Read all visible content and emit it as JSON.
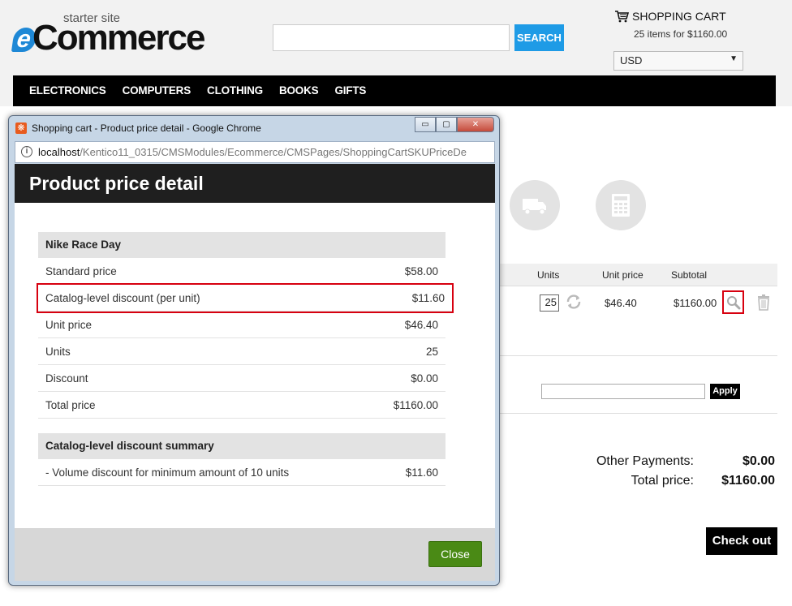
{
  "site": {
    "logo_tagline": "starter site",
    "logo_letter": "e",
    "logo_word": "Commerce",
    "search_placeholder": "",
    "search_button": "SEARCH",
    "cart_label": "SHOPPING CART",
    "cart_summary": "25 items for $1160.00",
    "currency": "USD",
    "nav": [
      "ELECTRONICS",
      "COMPUTERS",
      "CLOTHING",
      "BOOKS",
      "GIFTS"
    ]
  },
  "cart": {
    "columns": {
      "units": "Units",
      "unit_price": "Unit price",
      "subtotal": "Subtotal"
    },
    "row": {
      "units": "25",
      "unit_price": "$46.40",
      "subtotal": "$1160.00"
    },
    "coupon_apply": "Apply",
    "totals": [
      {
        "label": "Other Payments:",
        "value": "$0.00"
      },
      {
        "label": "Total price:",
        "value": "$1160.00"
      }
    ],
    "checkout": "Check out"
  },
  "window": {
    "title": "Shopping cart - Product price detail - Google Chrome",
    "url_host": "localhost",
    "url_path": "/Kentico11_0315/CMSModules/Ecommerce/CMSPages/ShoppingCartSKUPriceDe",
    "controls": {
      "minimize": "▭",
      "maximize": "▢",
      "close": "✕"
    }
  },
  "dialog": {
    "title": "Product price detail",
    "product_name": "Nike Race Day",
    "rows": [
      {
        "label": "Standard price",
        "value": "$58.00"
      },
      {
        "label": "Catalog-level discount (per unit)",
        "value": "$11.60"
      },
      {
        "label": "Unit price",
        "value": "$46.40"
      },
      {
        "label": "Units",
        "value": "25"
      },
      {
        "label": "Discount",
        "value": "$0.00"
      },
      {
        "label": "Total price",
        "value": "$1160.00"
      }
    ],
    "summary_title": "Catalog-level discount summary",
    "summary_rows": [
      {
        "label": "- Volume discount for minimum amount of 10 units",
        "value": "$11.60"
      }
    ],
    "close_button": "Close"
  },
  "colors": {
    "accent_blue": "#1e9be6",
    "highlight_red": "#d7000f",
    "close_green": "#4a8a15"
  }
}
